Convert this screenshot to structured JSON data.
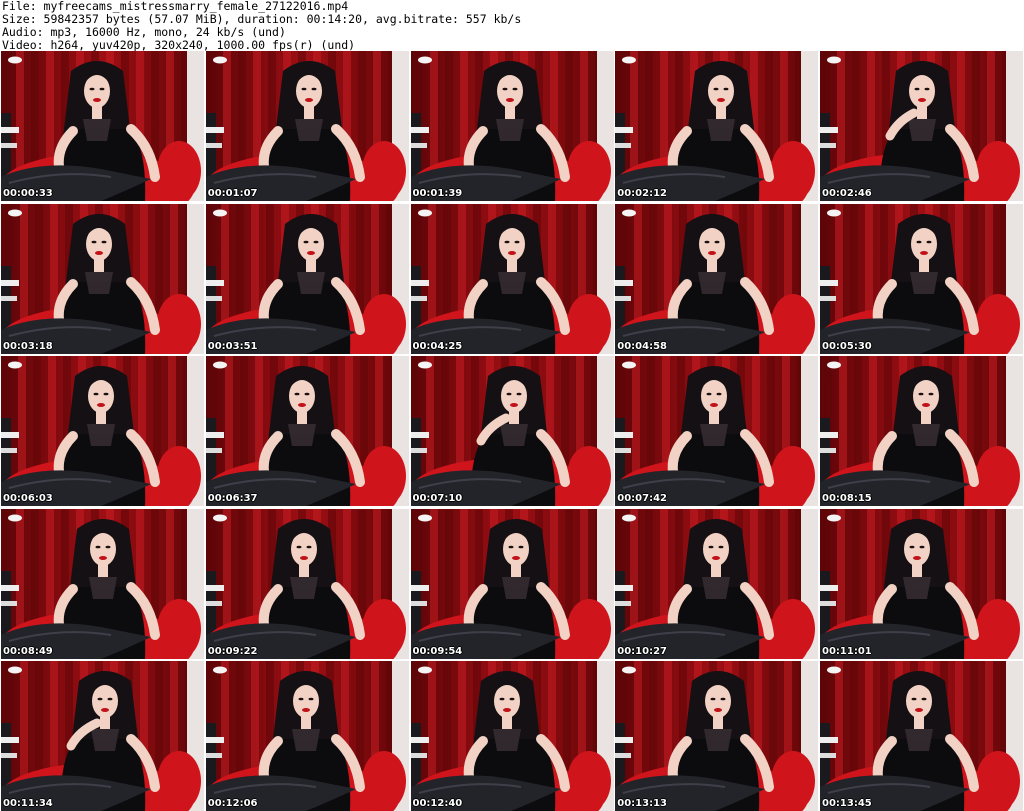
{
  "header": {
    "file_line": "File: myfreecams_mistressmarry_female_27122016.mp4",
    "size_line": "Size: 59842357 bytes (57.07 MiB), duration: 00:14:20, avg.bitrate: 557 kb/s",
    "audio_line": "Audio: mp3, 16000 Hz, mono, 24 kb/s (und)",
    "video_line": "Video: h264, yuv420p, 320x240, 1000.00 fps(r) (und)"
  },
  "colors": {
    "curtain_dark": "#5e0508",
    "curtain_mid": "#9e0f14",
    "curtain_light": "#c81d22",
    "chair_red": "#d0141b",
    "skin": "#f1d2c4",
    "hair": "#141014",
    "top": "#0c0b0e",
    "leather": "#23242a"
  },
  "thumbnails": [
    {
      "timestamp": "00:00:33"
    },
    {
      "timestamp": "00:01:07"
    },
    {
      "timestamp": "00:01:39"
    },
    {
      "timestamp": "00:02:12"
    },
    {
      "timestamp": "00:02:46"
    },
    {
      "timestamp": "00:03:18"
    },
    {
      "timestamp": "00:03:51"
    },
    {
      "timestamp": "00:04:25"
    },
    {
      "timestamp": "00:04:58"
    },
    {
      "timestamp": "00:05:30"
    },
    {
      "timestamp": "00:06:03"
    },
    {
      "timestamp": "00:06:37"
    },
    {
      "timestamp": "00:07:10"
    },
    {
      "timestamp": "00:07:42"
    },
    {
      "timestamp": "00:08:15"
    },
    {
      "timestamp": "00:08:49"
    },
    {
      "timestamp": "00:09:22"
    },
    {
      "timestamp": "00:09:54"
    },
    {
      "timestamp": "00:10:27"
    },
    {
      "timestamp": "00:11:01"
    },
    {
      "timestamp": "00:11:34"
    },
    {
      "timestamp": "00:12:06"
    },
    {
      "timestamp": "00:12:40"
    },
    {
      "timestamp": "00:13:13"
    },
    {
      "timestamp": "00:13:45"
    }
  ]
}
